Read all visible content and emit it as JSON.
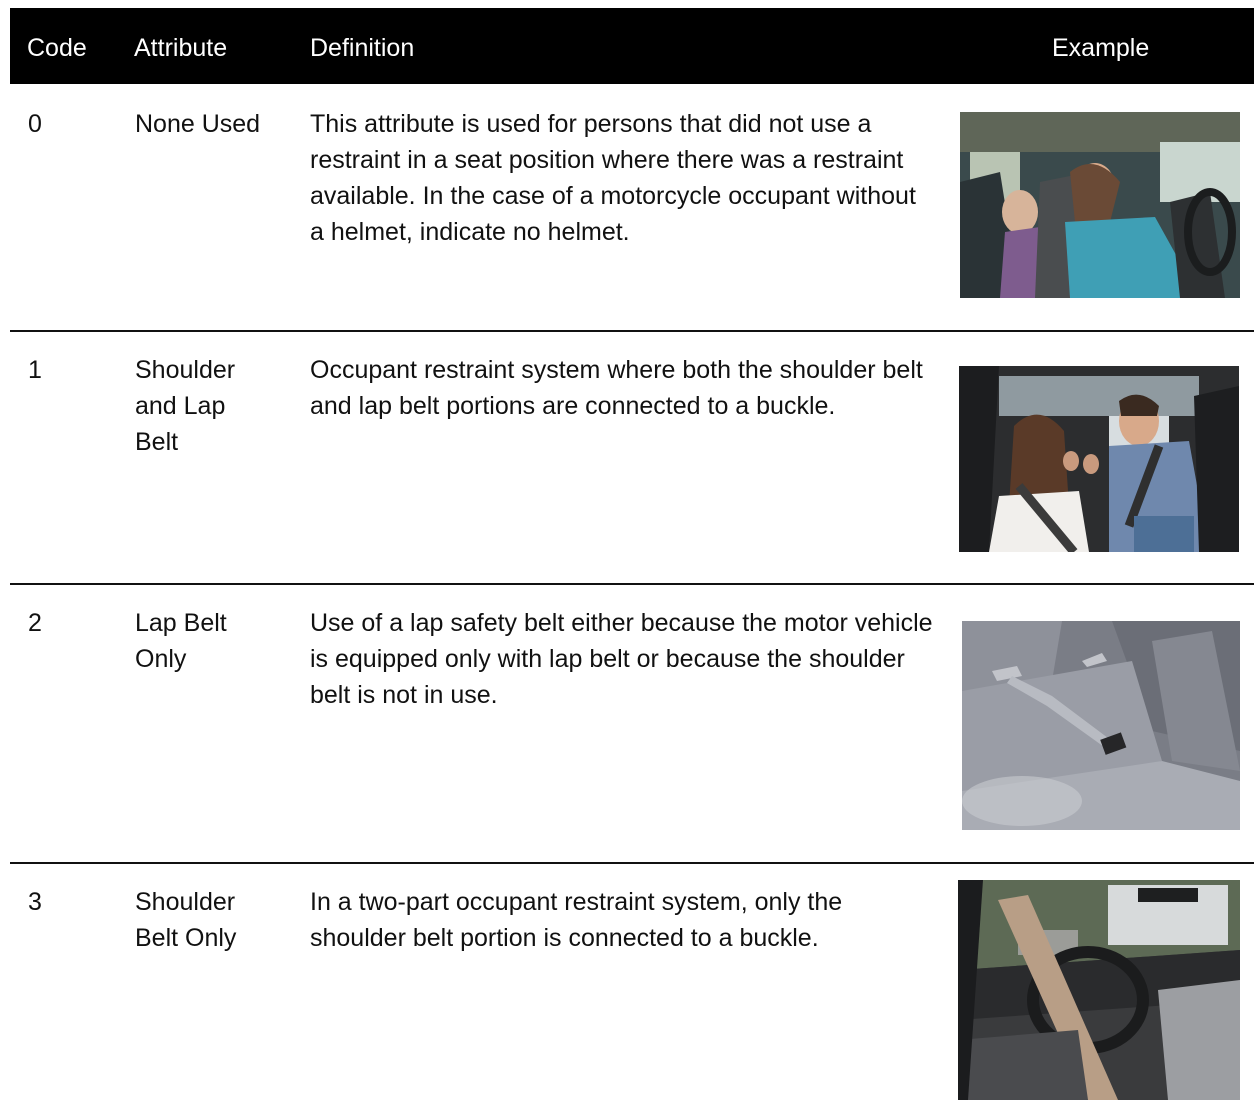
{
  "header": {
    "code": "Code",
    "attribute": "Attribute",
    "definition": "Definition",
    "example": "Example"
  },
  "rows": [
    {
      "code": "0",
      "attribute": "None Used",
      "definition": "This attribute is used for persons that did not use a restraint in a seat position where there was a restraint available. In the case of a motorcycle occupant without a helmet, indicate no helmet.",
      "example_photo": "woman-driving-child-unbelted-photo"
    },
    {
      "code": "1",
      "attribute": "Shoulder and Lap Belt",
      "definition": "Occupant restraint system where both the shoulder belt and lap belt portions are connected to a buckle.",
      "example_photo": "family-wearing-seatbelts-photo"
    },
    {
      "code": "2",
      "attribute": "Lap Belt Only",
      "definition": "Use of a lap safety belt either because the motor vehicle is equipped only with lap belt or because the shoulder belt is not in use.",
      "example_photo": "lap-belt-on-seat-photo"
    },
    {
      "code": "3",
      "attribute": "Shoulder Belt Only",
      "definition": "In a two-part occupant restraint system, only the shoulder belt portion is connected to a buckle.",
      "example_photo": "car-interior-shoulder-belt-photo"
    }
  ]
}
